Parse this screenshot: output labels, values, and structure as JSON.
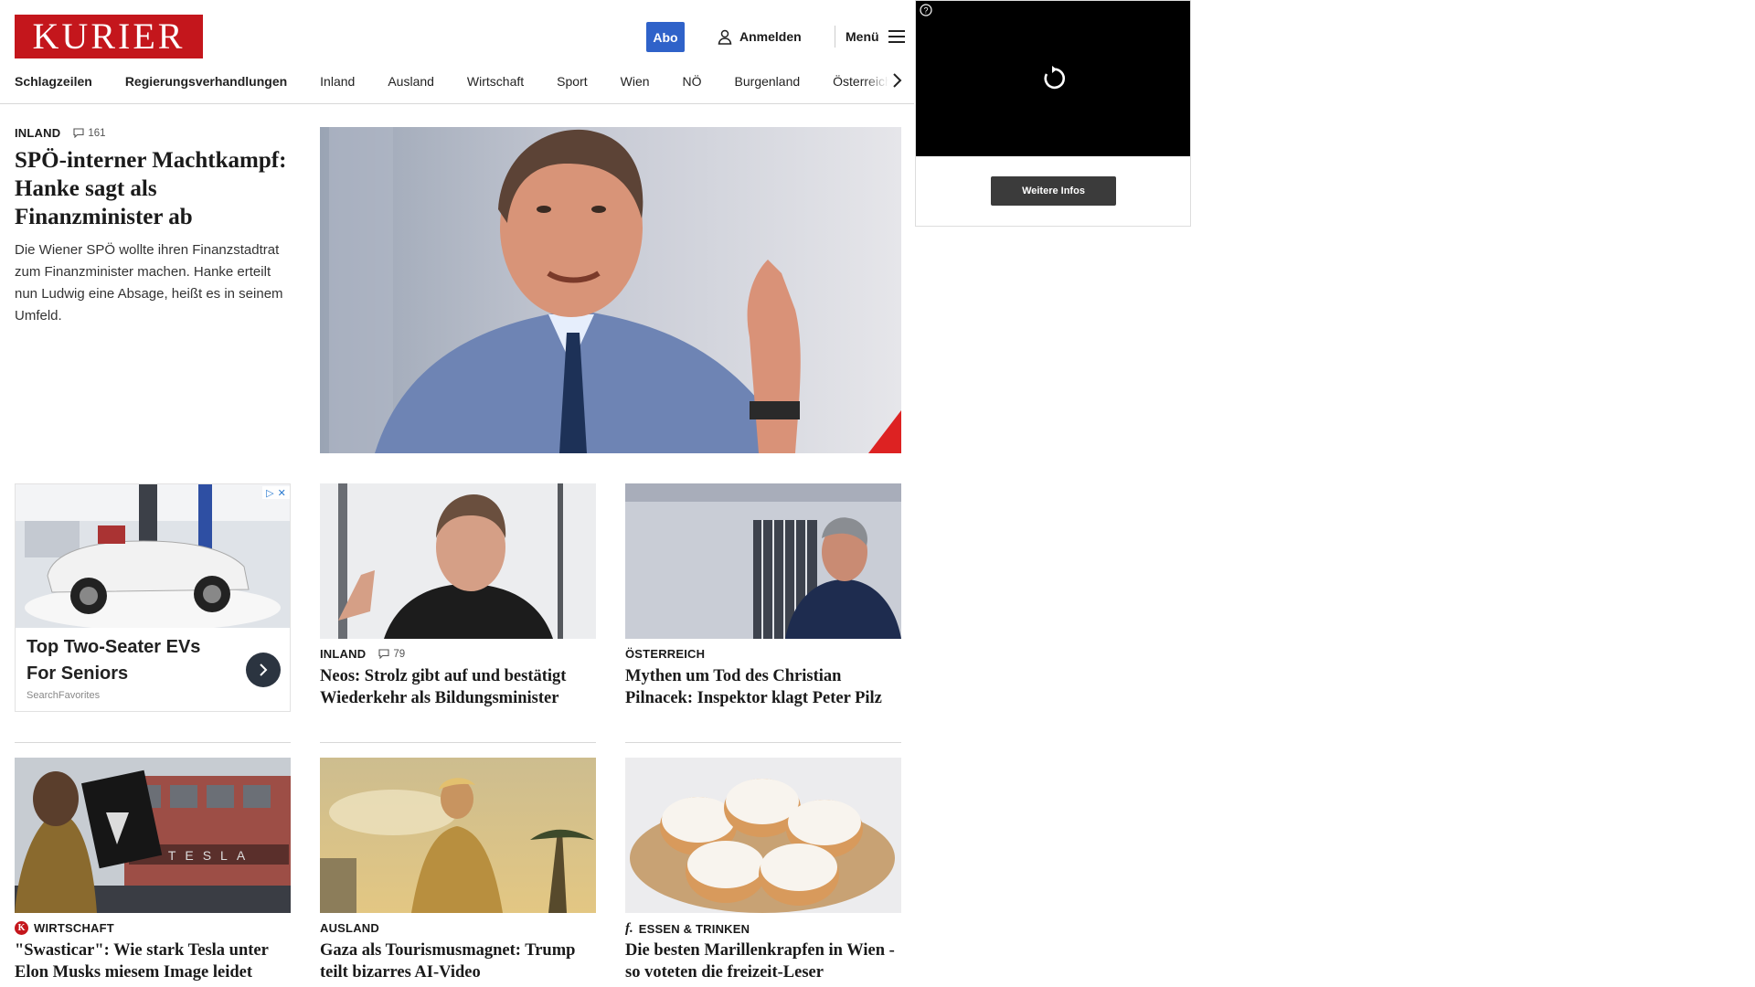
{
  "header": {
    "logo": "KURIER",
    "abo": "Abo",
    "login": "Anmelden",
    "menu": "Menü"
  },
  "nav": {
    "items": [
      "Schlagzeilen",
      "Regierungsverhandlungen",
      "Inland",
      "Ausland",
      "Wirtschaft",
      "Sport",
      "Wien",
      "NÖ",
      "Burgenland",
      "Österreich"
    ]
  },
  "hero": {
    "kicker": "INLAND",
    "comments": "161",
    "title": "SPÖ-interner Machtkampf: Hanke sagt als Finanzminister ab",
    "teaser": "Die Wiener SPÖ wollte ihren Finanzstadtrat zum Finanzminister machen. Hanke erteilt nun Ludwig eine Absage, heißt es in seinem Umfeld."
  },
  "ad": {
    "title": "Top Two-Seater EVs For Seniors",
    "source": "SearchFavorites"
  },
  "cards": [
    {
      "kicker": "INLAND",
      "comments": "79",
      "title": "Neos: Strolz gibt auf und bestätigt Wiederkehr als Bildungsminister"
    },
    {
      "kicker": "ÖSTERREICH",
      "title": "Mythen um Tod des Christian Pilnacek: Inspektor klagt Peter Pilz"
    },
    {
      "kicker": "WIRTSCHAFT",
      "brand": "K",
      "title": "\"Swasticar\": Wie stark Tesla unter Elon Musks miesem Image leidet"
    },
    {
      "kicker": "AUSLAND",
      "title": "Gaza als Tourismusmagnet: Trump teilt bizarres AI-Video"
    },
    {
      "kicker": "ESSEN & TRINKEN",
      "brand": "f.",
      "title": "Die besten Marillenkrapfen in Wien - so voteten die freizeit-Leser"
    }
  ],
  "video_ad": {
    "button": "Weitere Infos"
  },
  "colors": {
    "brand_red": "#c4161c",
    "abo_blue": "#2f62c9"
  }
}
